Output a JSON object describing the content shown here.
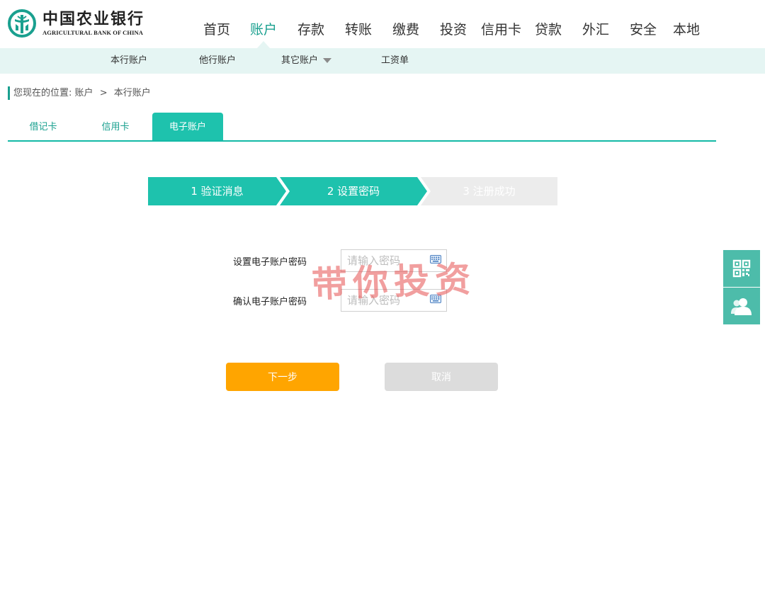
{
  "header": {
    "logo_cn": "中国农业银行",
    "logo_en": "AGRICULTURAL BANK OF CHINA",
    "nav": [
      "首页",
      "账户",
      "存款",
      "转账",
      "缴费",
      "投资",
      "信用卡",
      "贷款",
      "外汇",
      "安全",
      "本地"
    ],
    "active_nav": "账户"
  },
  "sub_nav": {
    "items": [
      "本行账户",
      "他行账户",
      "其它账户",
      "工资单"
    ]
  },
  "breadcrumb": {
    "prefix": "您现在的位置:",
    "level1": "账户",
    "separator": ">",
    "level2": "本行账户"
  },
  "tabs": {
    "items": [
      "借记卡",
      "信用卡",
      "电子账户"
    ],
    "active": "电子账户"
  },
  "steps": {
    "items": [
      "1 验证消息",
      "2 设置密码",
      "3 注册成功"
    ],
    "current": 2
  },
  "form": {
    "set_password_label": "设置电子账户密码",
    "set_password_placeholder": "请输入密码",
    "set_password_value": "",
    "confirm_password_label": "确认电子账户密码",
    "confirm_password_placeholder": "请输入密码",
    "confirm_password_value": ""
  },
  "watermark": "带你投资",
  "buttons": {
    "next": "下一步",
    "cancel": "取消"
  },
  "side_icons": [
    "qr-code-icon",
    "customer-service-icon"
  ],
  "colors": {
    "brand": "#1aa08f",
    "step_active": "#1ec2ad",
    "step_inactive": "#ececec",
    "subnav_bg": "#e5f5f3",
    "next_button": "#ffa500",
    "cancel_button": "#dcdcdc",
    "side_bar": "#4dbcaa"
  }
}
